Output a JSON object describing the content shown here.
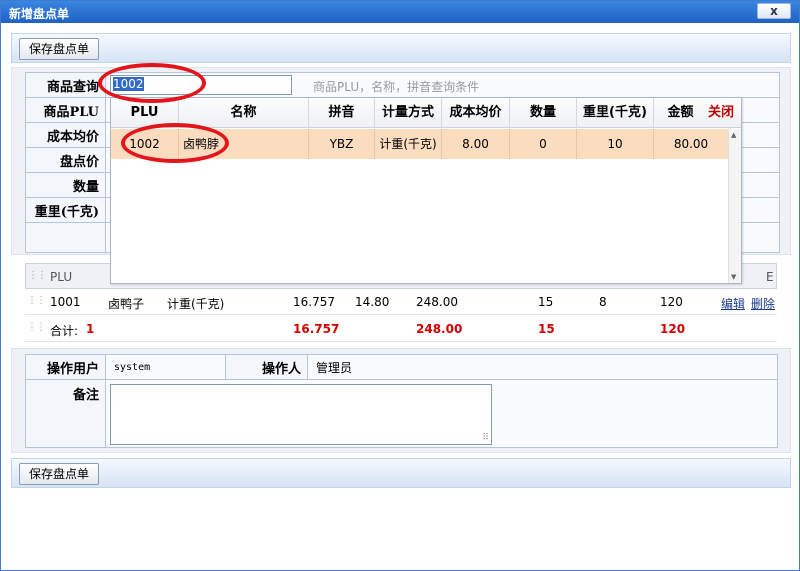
{
  "window": {
    "title": "新增盘点单",
    "close_glyph": "x"
  },
  "toolbar": {
    "save_label": "保存盘点单"
  },
  "form": {
    "search_label": "商品查询",
    "search_value": "1002",
    "search_hint": "商品PLU，名称，拼音查询条件",
    "plu_label": "商品PLU",
    "cost_label": "成本均价",
    "count_price_label": "盘点价",
    "qty_label": "数量",
    "weight_label": "重里(千克)"
  },
  "dropdown": {
    "headers": {
      "plu": "PLU",
      "name": "名称",
      "pinyin": "拼音",
      "unit": "计量方式",
      "cost": "成本均价",
      "qty": "数量",
      "weight": "重里(千克)",
      "amount": "金额"
    },
    "close_label": "关闭",
    "row": {
      "plu": "1002",
      "name": "卤鸭脖",
      "pinyin": "YBZ",
      "unit": "计重(千克)",
      "cost": "8.00",
      "qty": "0",
      "weight": "10",
      "amount": "80.00"
    }
  },
  "items": {
    "header_plu": "PLU",
    "header_last": "E",
    "rows": [
      {
        "plu": "1001",
        "name": "卤鸭子",
        "unit": "计重(千克)",
        "col4": "16.757",
        "col5": "14.80",
        "col6": "248.00",
        "col7": "15",
        "col8": "8",
        "col9": "120",
        "edit": "编辑",
        "delete": "删除"
      }
    ],
    "total": {
      "label": "合计:",
      "count": "1",
      "col4": "16.757",
      "col6": "248.00",
      "col7": "15",
      "col9": "120"
    }
  },
  "footer_form": {
    "user_label": "操作用户",
    "user_value": "system",
    "operator_label": "操作人",
    "operator_value": "管理员",
    "remark_label": "备注"
  },
  "colors": {
    "annotation": "#e5141b",
    "selection": "#3169c6",
    "highlight_row": "#fbdcbf",
    "total_red": "#d40000",
    "titlebar": "#1f62c4"
  }
}
